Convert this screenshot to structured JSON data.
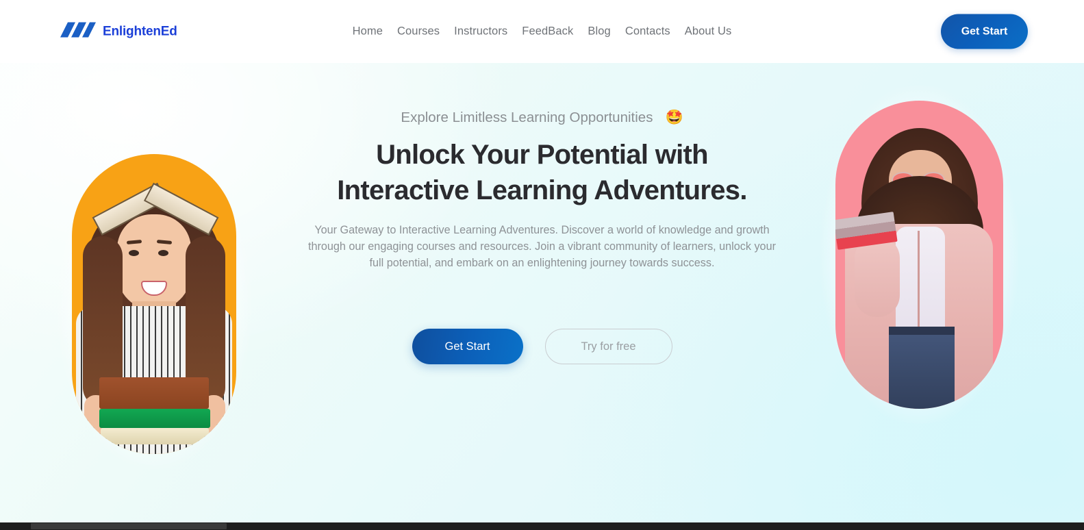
{
  "header": {
    "brand_name": "EnlightenEd",
    "logo_icon": "three-slanted-bars-logo",
    "logo_color": "#1b5fc4",
    "brand_text_color": "#1b3fd8",
    "nav_items": [
      {
        "label": "Home"
      },
      {
        "label": "Courses"
      },
      {
        "label": "Instructors"
      },
      {
        "label": "FeedBack"
      },
      {
        "label": "Blog"
      },
      {
        "label": "Contacts"
      },
      {
        "label": "About Us"
      }
    ],
    "cta_label": "Get Start",
    "cta_color": "#0c5fbb",
    "background": "#ffffff"
  },
  "hero": {
    "eyebrow": "Explore Limitless Learning Opportunities",
    "eyebrow_emoji": "🤩",
    "eyebrow_emoji_name": "star-struck-emoji",
    "headline_line1": "Unlock Your Potential with",
    "headline_line2": "Interactive Learning Adventures.",
    "headline_color": "#2b2b2f",
    "paragraph": "Your Gateway to Interactive Learning Adventures. Discover a world of knowledge and growth through our engaging courses and resources. Join a vibrant community of learners, unlock your full potential, and embark on an enlightening journey towards success.",
    "paragraph_color": "#8e9296",
    "primary_button": "Get Start",
    "secondary_button": "Try for free",
    "background_colors": [
      "#f8fefb",
      "#eefbf9",
      "#ddf8fc"
    ]
  },
  "media": {
    "left_image": {
      "name": "student-with-book-on-head-photo",
      "backdrop_color": "#f8a215",
      "shape": "pill"
    },
    "right_image": {
      "name": "student-with-sunglasses-photo",
      "backdrop_color": "#f98f9a",
      "shape": "pill"
    }
  },
  "scrollbar": {
    "orientation": "horizontal",
    "track_color": "#1e1e1e",
    "thumb_color": "#3a3a3a"
  }
}
